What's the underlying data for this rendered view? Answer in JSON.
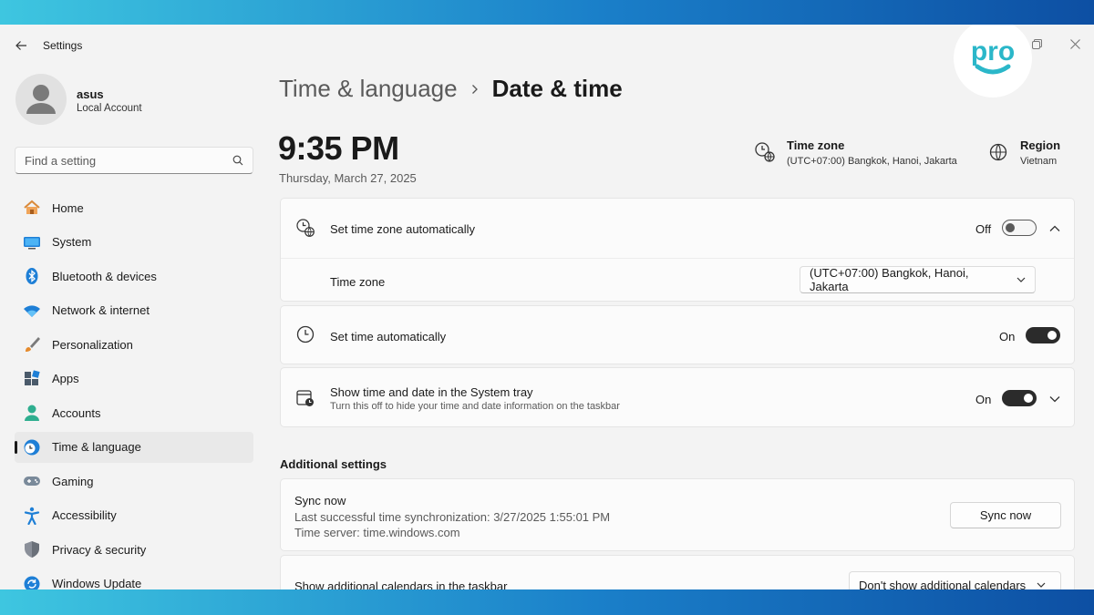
{
  "window": {
    "title": "Settings"
  },
  "logo": {
    "text": "pro",
    "color": "#2bb7c9"
  },
  "user": {
    "name": "asus",
    "account_type": "Local Account"
  },
  "search": {
    "placeholder": "Find a setting"
  },
  "sidebar": {
    "items": [
      {
        "label": "Home",
        "icon": "home-icon"
      },
      {
        "label": "System",
        "icon": "monitor-icon"
      },
      {
        "label": "Bluetooth & devices",
        "icon": "bluetooth-icon"
      },
      {
        "label": "Network & internet",
        "icon": "wifi-icon"
      },
      {
        "label": "Personalization",
        "icon": "brush-icon"
      },
      {
        "label": "Apps",
        "icon": "apps-icon"
      },
      {
        "label": "Accounts",
        "icon": "person-icon"
      },
      {
        "label": "Time & language",
        "icon": "clock-globe-icon",
        "active": true
      },
      {
        "label": "Gaming",
        "icon": "gamepad-icon"
      },
      {
        "label": "Accessibility",
        "icon": "accessibility-icon"
      },
      {
        "label": "Privacy & security",
        "icon": "shield-icon"
      },
      {
        "label": "Windows Update",
        "icon": "update-icon"
      }
    ]
  },
  "breadcrumb": {
    "parent": "Time & language",
    "current": "Date & time"
  },
  "clock": {
    "time": "9:35 PM",
    "date": "Thursday, March 27, 2025"
  },
  "header_info": {
    "timezone": {
      "title": "Time zone",
      "value": "(UTC+07:00) Bangkok, Hanoi, Jakarta"
    },
    "region": {
      "title": "Region",
      "value": "Vietnam"
    }
  },
  "settings": {
    "auto_timezone": {
      "label": "Set time zone automatically",
      "state": "Off"
    },
    "timezone_select": {
      "label": "Time zone",
      "value": "(UTC+07:00) Bangkok, Hanoi, Jakarta"
    },
    "auto_time": {
      "label": "Set time automatically",
      "state": "On"
    },
    "system_tray": {
      "label": "Show time and date in the System tray",
      "description": "Turn this off to hide your time and date information on the taskbar",
      "state": "On"
    }
  },
  "additional": {
    "title": "Additional settings",
    "sync": {
      "label": "Sync now",
      "last_sync": "Last successful time synchronization: 3/27/2025 1:55:01 PM",
      "server": "Time server: time.windows.com",
      "button": "Sync now"
    },
    "calendars": {
      "label": "Show additional calendars in the taskbar",
      "value": "Don't show additional calendars"
    }
  },
  "colors": {
    "accent_dark": "#2b2b2b",
    "background": "#f3f3f3",
    "card": "#fbfbfb",
    "frame": "#1a7fc9"
  }
}
